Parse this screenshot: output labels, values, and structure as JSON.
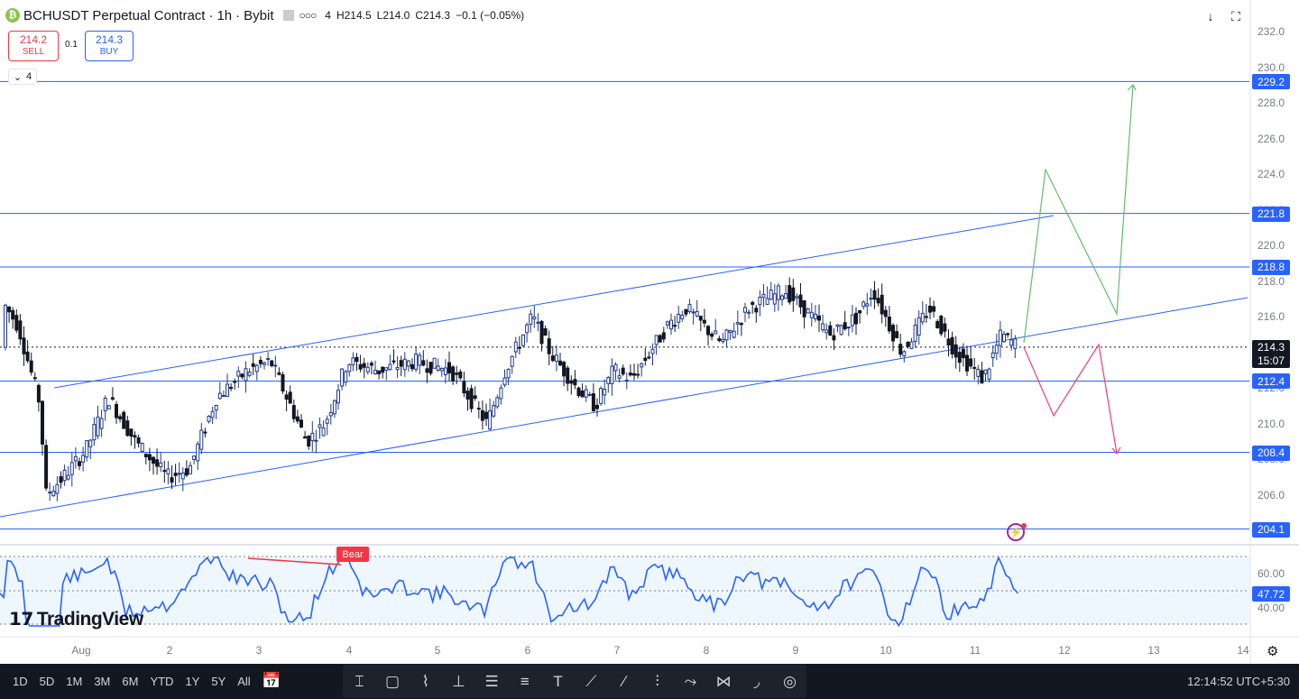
{
  "header": {
    "symbol": "BCHUSDT Perpetual Contract",
    "interval": "1h",
    "exchange": "Bybit",
    "coin_glyph": "₿",
    "ohlc": {
      "open": "4",
      "high": "H214.5",
      "low": "L214.0",
      "close": "C214.3",
      "change": "−0.1 (−0.05%)"
    }
  },
  "trade": {
    "sell_price": "214.2",
    "sell_label": "SELL",
    "buy_price": "214.3",
    "buy_label": "BUY",
    "spread": "0.1"
  },
  "indicators_collapse": {
    "count": "4"
  },
  "price_axis": {
    "ticks": [
      "232.0",
      "230.0",
      "228.0",
      "226.0",
      "224.0",
      "222.0",
      "220.0",
      "218.0",
      "216.0",
      "214.0",
      "212.0",
      "210.0",
      "208.0",
      "206.0"
    ],
    "ylim": [
      205.4,
      232.4
    ]
  },
  "levels": [
    "229.2",
    "221.8",
    "218.8",
    "212.4",
    "208.4",
    "204.1"
  ],
  "current_price": {
    "value": "214.3",
    "countdown": "15:07"
  },
  "rsi": {
    "value": "47.72",
    "ticks": [
      "60.00",
      "40.00"
    ],
    "divergence_label": "Bear"
  },
  "time_axis": [
    "Aug",
    "2",
    "3",
    "4",
    "5",
    "6",
    "7",
    "8",
    "9",
    "10",
    "11",
    "12",
    "13",
    "14"
  ],
  "chart_data": {
    "type": "candlestick",
    "interval": "1h",
    "y_range": [
      204,
      232
    ],
    "horizontal_levels": [
      229.2,
      221.8,
      218.8,
      212.4,
      208.4,
      204.1
    ],
    "current_price": 214.3,
    "rsi_current": 47.72,
    "colors": {
      "up": "#1e3a8a",
      "down": "#131722",
      "levels": "#2962ff",
      "bull_path": "#66bb6a",
      "bear_path": "#ec407a",
      "rsi": "#2962ff"
    }
  },
  "bottombar": {
    "ranges": [
      "1D",
      "5D",
      "1M",
      "3M",
      "6M",
      "YTD",
      "1Y",
      "5Y",
      "All"
    ],
    "clock": "12:14:52 UTC+5:30"
  },
  "watermark": "TradingView",
  "colors": {
    "accent": "#2962ff",
    "sell": "#f23645",
    "bar_bg": "#131722"
  }
}
